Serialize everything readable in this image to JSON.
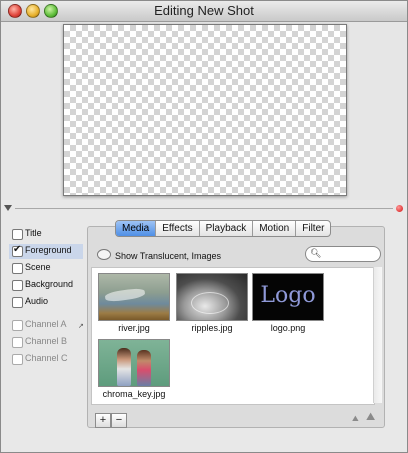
{
  "window": {
    "title": "Editing New Shot"
  },
  "layers": [
    {
      "label": "Title",
      "checked": false
    },
    {
      "label": "Foreground",
      "checked": true
    },
    {
      "label": "Scene",
      "checked": false
    },
    {
      "label": "Background",
      "checked": false
    },
    {
      "label": "Audio",
      "checked": false
    },
    {
      "label": "Channel A",
      "checked": false
    },
    {
      "label": "Channel B",
      "checked": false
    },
    {
      "label": "Channel C",
      "checked": false
    }
  ],
  "tabs": [
    "Media",
    "Effects",
    "Playback",
    "Motion",
    "Filter"
  ],
  "active_tab": "Media",
  "translucent_label": "Show Translucent, Images",
  "media": [
    {
      "name": "river.jpg"
    },
    {
      "name": "ripples.jpg"
    },
    {
      "name": "logo.png",
      "thumb_text": "Logo"
    },
    {
      "name": "chroma_key.jpg"
    }
  ],
  "buttons": {
    "add": "+",
    "remove": "−"
  },
  "colors": {
    "accent": "#4f8fe6",
    "selection": "#cad6ea",
    "alert": "#d41010"
  }
}
